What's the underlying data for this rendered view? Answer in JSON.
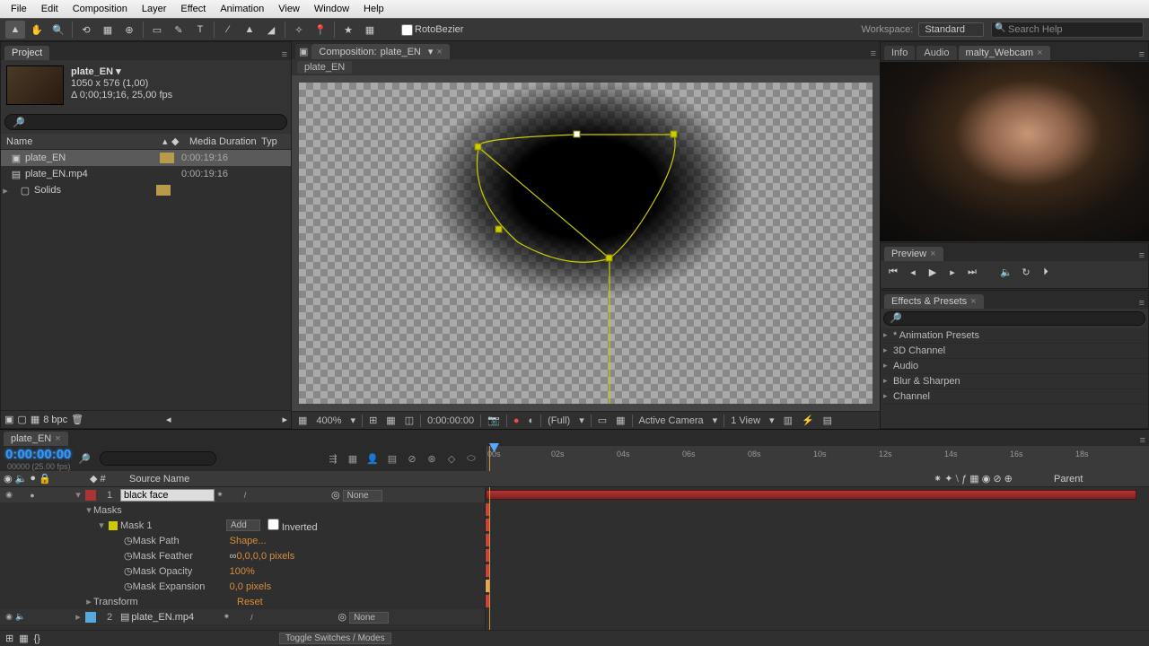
{
  "menu": [
    "File",
    "Edit",
    "Composition",
    "Layer",
    "Effect",
    "Animation",
    "View",
    "Window",
    "Help"
  ],
  "toolbar": {
    "roto_label": "RotoBezier",
    "workspace_label": "Workspace:",
    "workspace_value": "Standard",
    "search_placeholder": "Search Help"
  },
  "project": {
    "tab": "Project",
    "item_name": "plate_EN ▾",
    "dims": "1050 x 576 (1,00)",
    "dur": "Δ 0;00;19;16, 25,00 fps",
    "cols": {
      "name": "Name",
      "label": "",
      "dur": "Media Duration",
      "type": "Typ"
    },
    "rows": [
      {
        "icon": "▣",
        "name": "plate_EN",
        "label": "#b89a4a",
        "dur": "0:00:19:16",
        "sel": true
      },
      {
        "icon": "▤",
        "name": "plate_EN.mp4",
        "label": "",
        "dur": "0:00:19:16",
        "sel": false
      },
      {
        "icon": "▸ ▢",
        "name": "Solids",
        "label": "#b89a4a",
        "dur": "",
        "sel": false
      }
    ],
    "bpc": "8 bpc"
  },
  "comp": {
    "tab_prefix": "Composition:",
    "tab_name": "plate_EN",
    "crumb": "plate_EN",
    "bottom": {
      "zoom": "400%",
      "time": "0:00:00:00",
      "res": "(Full)",
      "cam": "Active Camera",
      "view": "1 View"
    }
  },
  "right": {
    "info_tab": "Info",
    "audio_tab": "Audio",
    "webcam_tab": "malty_Webcam",
    "preview_tab": "Preview",
    "effects_tab": "Effects & Presets",
    "effects": [
      "* Animation Presets",
      "3D Channel",
      "Audio",
      "Blur & Sharpen",
      "Channel"
    ]
  },
  "timeline": {
    "tab": "plate_EN",
    "timecode": "0:00:00:00",
    "timecode_sub": "00000 (25.00 fps)",
    "ticks": [
      "00s",
      "02s",
      "04s",
      "06s",
      "08s",
      "10s",
      "12s",
      "14s",
      "16s",
      "18s"
    ],
    "cols": {
      "src": "Source Name",
      "parent": "Parent"
    },
    "layer1": {
      "idx": "1",
      "name": "black face",
      "mode": "None"
    },
    "masks_label": "Masks",
    "mask1": {
      "name": "Mask 1",
      "mode": "Add",
      "inv": "Inverted"
    },
    "props": {
      "path": {
        "n": "Mask Path",
        "v": "Shape..."
      },
      "feather": {
        "n": "Mask Feather",
        "v": "0,0,0,0 pixels"
      },
      "opacity": {
        "n": "Mask Opacity",
        "v": "100%"
      },
      "expansion": {
        "n": "Mask Expansion",
        "v": "0,0 pixels"
      }
    },
    "transform": {
      "n": "Transform",
      "v": "Reset"
    },
    "layer2": {
      "idx": "2",
      "name": "plate_EN.mp4",
      "mode": "None"
    },
    "toggle": "Toggle Switches / Modes"
  },
  "chart_data": null
}
